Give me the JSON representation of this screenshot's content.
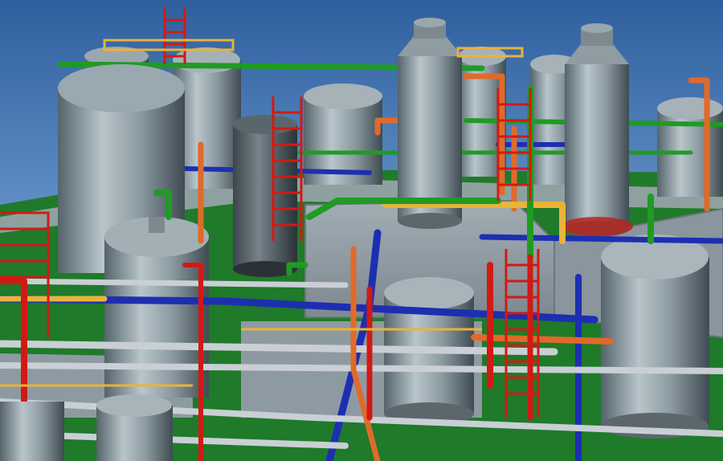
{
  "scene": {
    "description_type": "3d-plant-model-render",
    "palette": {
      "sky_top": "#2f5f9e",
      "sky_bottom": "#9fc3e6",
      "ground": "#1f7a2a",
      "slab": "#8f9aa3",
      "vessel_light": "#a9b6bd",
      "vessel_dark": "#4e5b63",
      "pipe_red": "#d11a14",
      "pipe_blue": "#1d2fb0",
      "pipe_green": "#1f9b24",
      "pipe_orange": "#e06a2a",
      "pipe_gray": "#c9cfd4",
      "pipe_yellow": "#e9b33a"
    },
    "objects": [
      "vessel",
      "column",
      "pipe",
      "ladder",
      "platform"
    ]
  }
}
